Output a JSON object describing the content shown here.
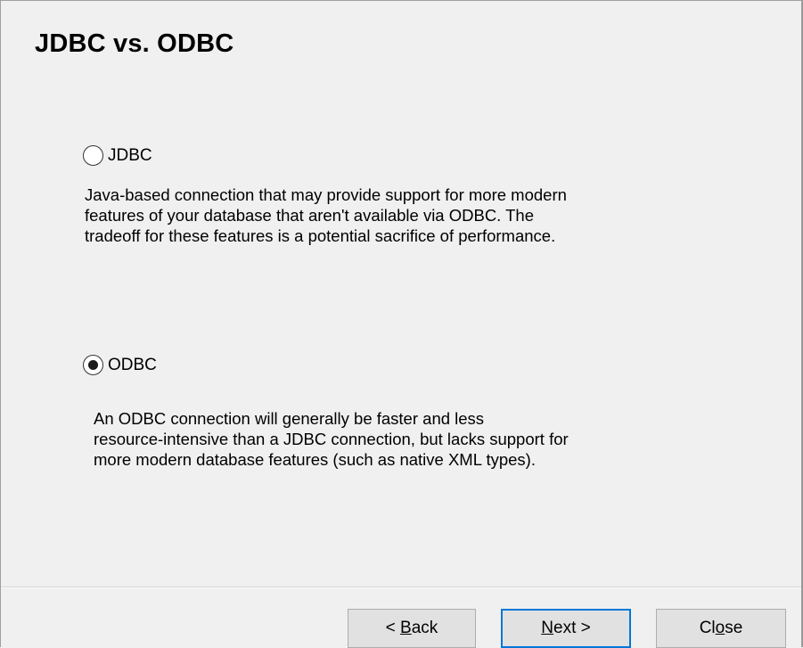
{
  "dialog": {
    "title": "JDBC vs. ODBC",
    "options": [
      {
        "label": "JDBC",
        "selected": false,
        "description_lines": [
          "Java-based connection that may provide support for more modern",
          "features of your database that aren't available via ODBC. The",
          "tradeoff for these features is a potential sacrifice of performance."
        ]
      },
      {
        "label": "ODBC",
        "selected": true,
        "description_lines": [
          "An ODBC connection will generally be faster and less",
          "resource-intensive than a JDBC connection, but lacks support for",
          "more modern database features (such as native XML types)."
        ]
      }
    ],
    "buttons": {
      "back": {
        "prefix": "< ",
        "mnemonic": "B",
        "rest": "ack"
      },
      "next": {
        "mnemonic": "N",
        "rest": "ext >"
      },
      "close": {
        "prefix": "Cl",
        "mnemonic": "o",
        "rest": "se"
      }
    },
    "colors": {
      "background": "#f0f0f0",
      "default_button_border": "#0078d7"
    }
  }
}
